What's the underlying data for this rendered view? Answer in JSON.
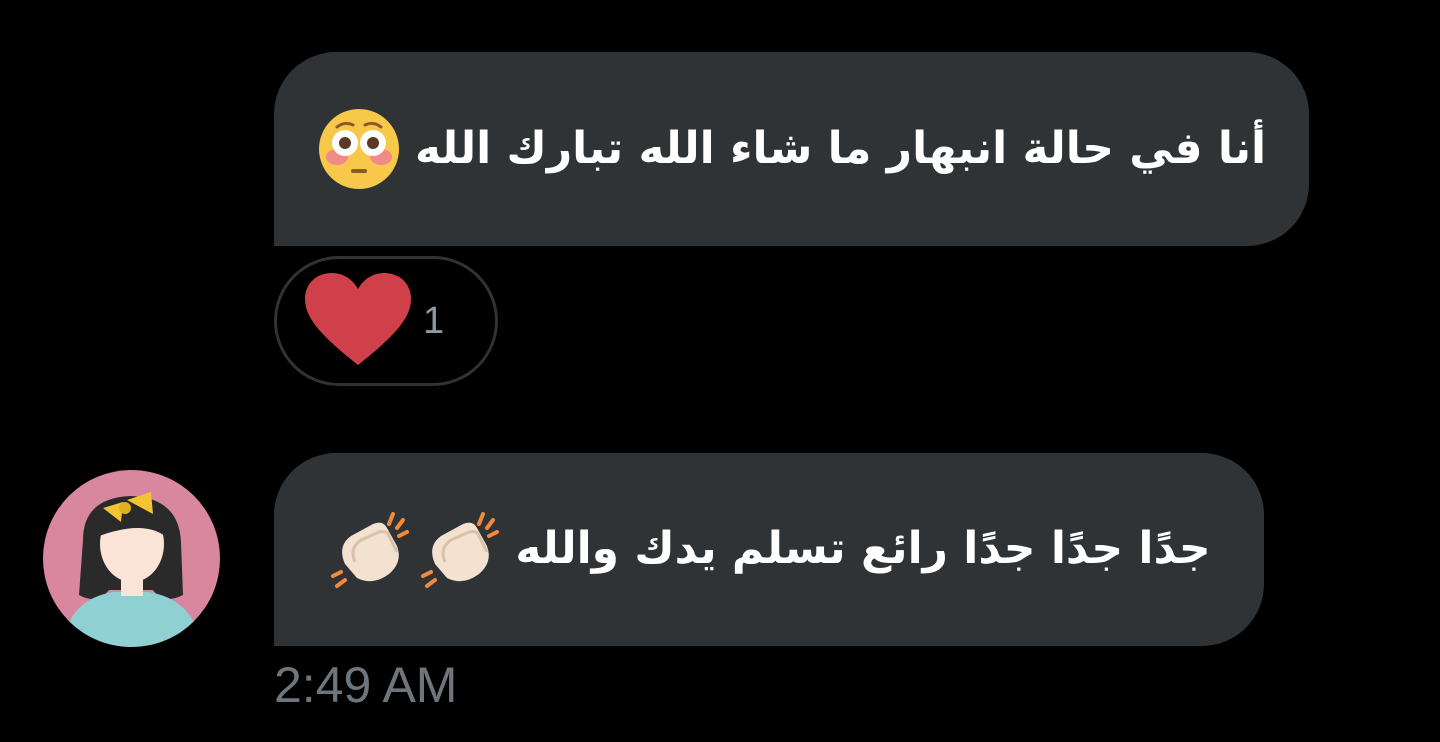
{
  "messages": [
    {
      "text": "أنا في حالة انبهار ما شاء الله تبارك الله",
      "emoji": "flushed-face",
      "reaction": {
        "icon": "heart",
        "count": "1"
      }
    },
    {
      "text": "جدًا جدًا جدًا رائع تسلم يدك والله",
      "emoji": [
        "clapping-hands",
        "clapping-hands"
      ],
      "timestamp": "2:49 AM"
    }
  ],
  "colors": {
    "background": "#000000",
    "bubble": "#2f3336",
    "text": "#ffffff",
    "muted": "#6e767d",
    "heart": "#d0404a"
  }
}
